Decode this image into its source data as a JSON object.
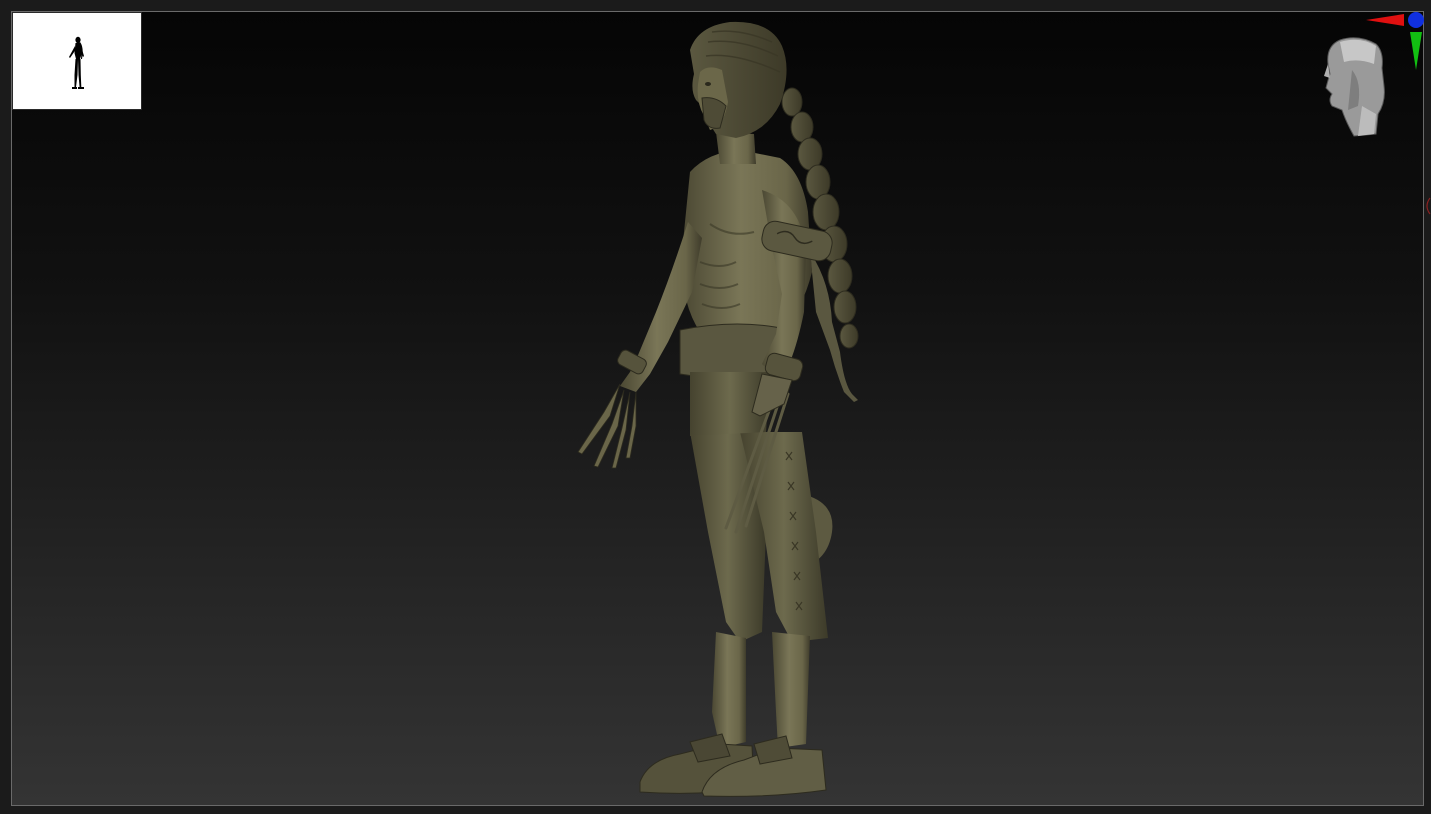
{
  "app": {
    "title": "",
    "accent_color": "#ffffff"
  },
  "viewport": {
    "background_top": "#050505",
    "background_bottom": "#343434",
    "border_color": "#6a6a6a"
  },
  "navigator": {
    "background": "#ffffff",
    "silhouette_color": "#000000",
    "icon": "figure-silhouette-icon"
  },
  "gizmo": {
    "icon": "head-orientation-icon",
    "axis_colors": {
      "x": "#e01010",
      "y": "#12c012",
      "z": "#1030e0"
    }
  },
  "model": {
    "icon": "sculpted-character-model",
    "material_color": "#6e6a4e"
  }
}
